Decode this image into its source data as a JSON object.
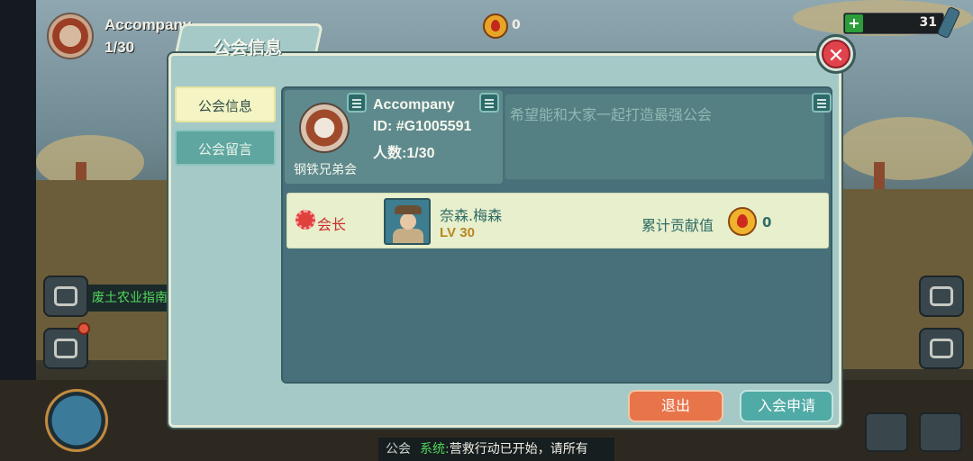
{
  "hud": {
    "guild_name": "Accompany",
    "member_count": "1/30",
    "fire_value": "0",
    "bar_value": "31"
  },
  "background": {
    "guide_text": "废土农业指南",
    "chat": {
      "channel": "公会",
      "system_label": "系统:",
      "message": "营救行动已开始，请所有"
    }
  },
  "dialog": {
    "title": "公会信息",
    "close_symbol": "✕",
    "nav": [
      {
        "label": "公会信息",
        "active": true
      },
      {
        "label": "公会留言",
        "active": false
      }
    ],
    "guild": {
      "name": "Accompany",
      "id": "ID: #G1005591",
      "members": "人数:1/30",
      "faction": "钢铁兄弟会",
      "motto_placeholder": "希望能和大家一起打造最强公会"
    },
    "member": {
      "role": "会长",
      "name": "奈森.梅森",
      "level": "LV 30",
      "contribution_label": "累计贡献值",
      "contribution_value": "0"
    },
    "buttons": {
      "exit": "退出",
      "apply": "入会申请"
    }
  },
  "colors": {
    "dialog_bg": "#a5c9c6",
    "content_bg": "#48707a",
    "exit_button": "#e8744a",
    "apply_button": "#50aaa5",
    "leader_red": "#c82e2a"
  }
}
